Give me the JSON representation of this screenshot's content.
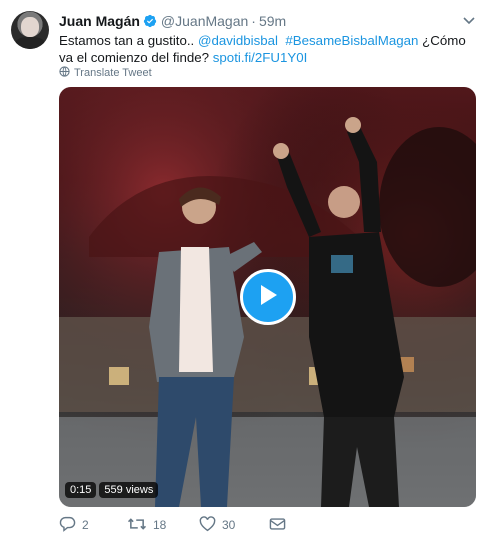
{
  "tweet": {
    "author_name": "Juan Magán",
    "handle": "@JuanMagan",
    "separator": "·",
    "time": "59m",
    "text_plain": "Estamos tan a gustito.. ",
    "mention": "@davidbisbal",
    "space": "  ",
    "hashtag": "#BesameBisbalMagan",
    "text_after_hashtag": " ¿Cómo va el comienzo del finde? ",
    "url": "spoti.fi/2FU1Y0I",
    "translate_label": "Translate Tweet",
    "video": {
      "duration": "0:15",
      "views": "559 views"
    },
    "counts": {
      "replies": "2",
      "retweets": "18",
      "likes": "30"
    },
    "colors": {
      "link": "#1b95e0",
      "secondary_text": "#657786",
      "play_button": "#1da1f2",
      "verified": "#1da1f2"
    },
    "icons": {
      "verified": "verified-badge-icon",
      "caret": "chevron-down-icon",
      "globe": "globe-icon",
      "play": "play-icon",
      "reply": "reply-icon",
      "retweet": "retweet-icon",
      "like": "heart-icon",
      "dm": "envelope-icon"
    }
  }
}
